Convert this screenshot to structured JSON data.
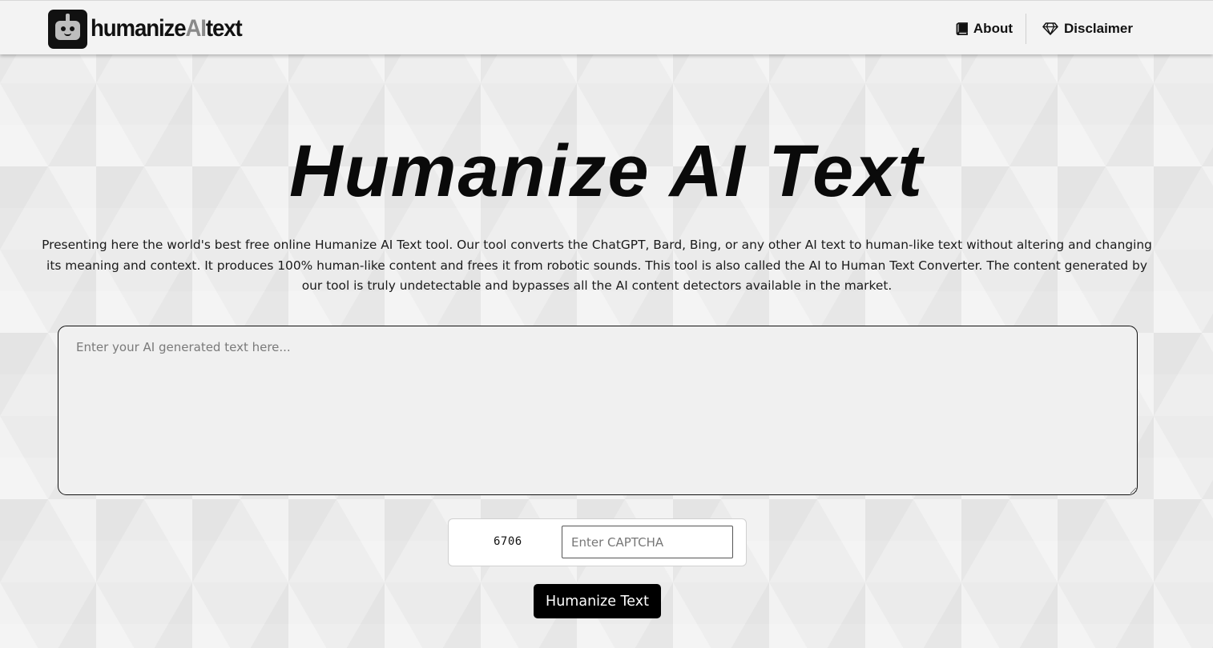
{
  "header": {
    "logo": {
      "text_dark": "humanize",
      "text_grey": "AI",
      "text_dark_end": "text",
      "icon": "robot-icon"
    },
    "nav": [
      {
        "label": "About",
        "icon": "book-icon"
      },
      {
        "label": "Disclaimer",
        "icon": "diamond-icon"
      }
    ]
  },
  "main": {
    "title": "Humanize AI Text",
    "intro": "Presenting here the world's best free online Humanize AI Text tool. Our tool converts the ChatGPT, Bard, Bing, or any other AI text to human-like text without altering and changing its meaning and context. It produces 100% human-like content and frees it from robotic sounds. This tool is also called the AI to Human Text Converter. The content generated by our tool is truly undetectable and bypasses all the AI content detectors available in the market.",
    "textarea": {
      "value": "",
      "placeholder": "Enter your AI generated text here..."
    },
    "captcha": {
      "code": "6706",
      "value": "",
      "placeholder": "Enter CAPTCHA"
    },
    "submit_label": "Humanize Text"
  },
  "colors": {
    "accent": "#000000",
    "header_bg": "#f3f3f3",
    "logo_grey": "#8a8a8a",
    "page_bg": "#ebebeb"
  }
}
